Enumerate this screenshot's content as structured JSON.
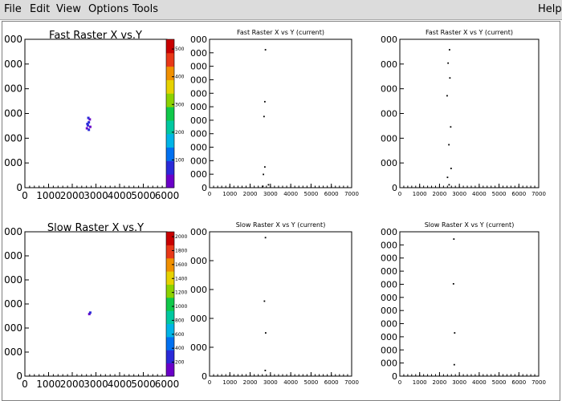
{
  "menu": {
    "file": "File",
    "edit": "Edit",
    "view": "View",
    "options": "Options",
    "tools": "Tools",
    "help": "Help"
  },
  "chart_data": [
    {
      "type": "heatmap",
      "title": "Fast Raster X vs.Y",
      "xlim": [
        0,
        6000
      ],
      "x_ticks": [
        "0",
        "1000",
        "2000",
        "3000",
        "4000",
        "5000",
        "6000"
      ],
      "y_ticks": [
        "0",
        "000",
        "000",
        "000",
        "000",
        "000",
        "000"
      ],
      "colorbar_ticks": [
        "100",
        "200",
        "300",
        "400",
        "500"
      ],
      "points": [
        {
          "x": 2620,
          "y": 0.4
        },
        {
          "x": 2660,
          "y": 0.42
        },
        {
          "x": 2700,
          "y": 0.44
        },
        {
          "x": 2740,
          "y": 0.46
        },
        {
          "x": 2640,
          "y": 0.43
        },
        {
          "x": 2700,
          "y": 0.39
        },
        {
          "x": 2760,
          "y": 0.41
        },
        {
          "x": 2680,
          "y": 0.47
        }
      ]
    },
    {
      "type": "scatter",
      "title": "Fast Raster X vs Y (current)",
      "xlim": [
        0,
        7000
      ],
      "x_ticks": [
        "0",
        "1000",
        "2000",
        "3000",
        "4000",
        "5000",
        "6000",
        "7000"
      ],
      "y_ticks": [
        "0",
        "000",
        "000",
        "000",
        "000",
        "000",
        "000",
        "000",
        "000",
        "000",
        "000",
        "000"
      ],
      "points": [
        {
          "x": 2750,
          "y": 0.93
        },
        {
          "x": 2720,
          "y": 0.58
        },
        {
          "x": 2680,
          "y": 0.48
        },
        {
          "x": 2720,
          "y": 0.14
        },
        {
          "x": 2650,
          "y": 0.09
        },
        {
          "x": 2900,
          "y": 0.02
        },
        {
          "x": 2620,
          "y": 0.01
        }
      ]
    },
    {
      "type": "scatter",
      "title": "Fast Raster X vs Y (current)",
      "xlim": [
        0,
        7000
      ],
      "x_ticks": [
        "0",
        "1000",
        "2000",
        "3000",
        "4000",
        "5000",
        "6000",
        "7000"
      ],
      "y_ticks": [
        "0",
        "000",
        "000",
        "000",
        "000",
        "000",
        "000"
      ],
      "points": [
        {
          "x": 2500,
          "y": 0.93
        },
        {
          "x": 2430,
          "y": 0.84
        },
        {
          "x": 2520,
          "y": 0.74
        },
        {
          "x": 2380,
          "y": 0.62
        },
        {
          "x": 2560,
          "y": 0.41
        },
        {
          "x": 2470,
          "y": 0.29
        },
        {
          "x": 2580,
          "y": 0.13
        },
        {
          "x": 2400,
          "y": 0.07
        },
        {
          "x": 2480,
          "y": 0.02
        }
      ]
    },
    {
      "type": "heatmap",
      "title": "Slow Raster X vs.Y",
      "xlim": [
        0,
        6000
      ],
      "x_ticks": [
        "0",
        "1000",
        "2000",
        "3000",
        "4000",
        "5000",
        "6000"
      ],
      "y_ticks": [
        "0",
        "000",
        "000",
        "000",
        "000",
        "000",
        "000"
      ],
      "colorbar_ticks": [
        "200",
        "400",
        "600",
        "800",
        "1000",
        "1200",
        "1400",
        "1600",
        "1800",
        "2000"
      ],
      "points": [
        {
          "x": 2720,
          "y": 0.43
        },
        {
          "x": 2760,
          "y": 0.44
        }
      ]
    },
    {
      "type": "scatter",
      "title": "Slow Raster X vs Y (current)",
      "xlim": [
        0,
        7000
      ],
      "x_ticks": [
        "0",
        "1000",
        "2000",
        "3000",
        "4000",
        "5000",
        "6000",
        "7000"
      ],
      "y_ticks": [
        "0",
        "000",
        "000",
        "000",
        "000",
        "000"
      ],
      "points": [
        {
          "x": 2750,
          "y": 0.96
        },
        {
          "x": 2700,
          "y": 0.52
        },
        {
          "x": 2760,
          "y": 0.3
        },
        {
          "x": 2740,
          "y": 0.04
        }
      ]
    },
    {
      "type": "scatter",
      "title": "Slow Raster X vs Y (current)",
      "xlim": [
        0,
        7000
      ],
      "x_ticks": [
        "0",
        "1000",
        "2000",
        "3000",
        "4000",
        "5000",
        "6000",
        "7000"
      ],
      "y_ticks": [
        "0",
        "000",
        "000",
        "000",
        "000",
        "000",
        "000",
        "000",
        "000",
        "000",
        "000",
        "000"
      ],
      "points": [
        {
          "x": 2720,
          "y": 0.95
        },
        {
          "x": 2700,
          "y": 0.64
        },
        {
          "x": 2760,
          "y": 0.3
        },
        {
          "x": 2740,
          "y": 0.08
        }
      ]
    }
  ]
}
